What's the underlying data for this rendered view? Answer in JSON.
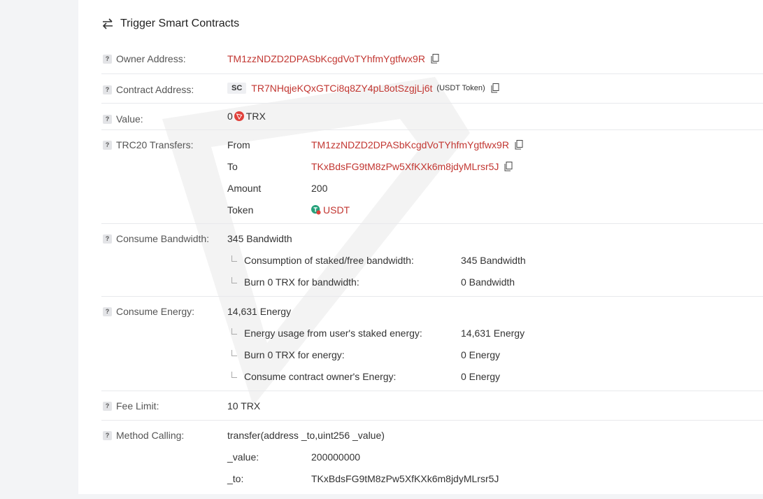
{
  "header": {
    "title": "Trigger Smart Contracts"
  },
  "owner": {
    "label": "Owner Address:",
    "address": "TM1zzNDZD2DPASbKcgdVoTYhfmYgtfwx9R"
  },
  "contract": {
    "label": "Contract Address:",
    "badge": "SC",
    "address": "TR7NHqjeKQxGTCi8q8ZY4pL8otSzgjLj6t",
    "note": "(USDT Token)"
  },
  "value": {
    "label": "Value:",
    "amount": "0",
    "unit": "TRX"
  },
  "trc20": {
    "label": "TRC20 Transfers:",
    "from_label": "From",
    "from": "TM1zzNDZD2DPASbKcgdVoTYhfmYgtfwx9R",
    "to_label": "To",
    "to": "TKxBdsFG9tM8zPw5XfKXk6m8jdyMLrsr5J",
    "amount_label": "Amount",
    "amount": "200",
    "token_label": "Token",
    "token": "USDT"
  },
  "bandwidth": {
    "label": "Consume Bandwidth:",
    "total": "345 Bandwidth",
    "items": [
      {
        "k": "Consumption of staked/free bandwidth:",
        "v": "345 Bandwidth"
      },
      {
        "k": "Burn 0 TRX for bandwidth:",
        "v": "0 Bandwidth"
      }
    ]
  },
  "energy": {
    "label": "Consume Energy:",
    "total": "14,631 Energy",
    "items": [
      {
        "k": "Energy usage from user's staked energy:",
        "v": "14,631 Energy"
      },
      {
        "k": "Burn 0 TRX for energy:",
        "v": "0 Energy"
      },
      {
        "k": "Consume contract owner's Energy:",
        "v": "0 Energy"
      }
    ]
  },
  "fee": {
    "label": "Fee Limit:",
    "value": "10 TRX"
  },
  "method": {
    "label": "Method Calling:",
    "signature": "transfer(address _to,uint256 _value)",
    "params": [
      {
        "k": "_value:",
        "v": "200000000"
      },
      {
        "k": "_to:",
        "v": "TKxBdsFG9tM8zPw5XfKXk6m8jdyMLrsr5J"
      }
    ]
  },
  "colors": {
    "link": "#c23631",
    "border": "#e8e9ec",
    "trx": "#e0403a",
    "usdt": "#26a17b"
  }
}
